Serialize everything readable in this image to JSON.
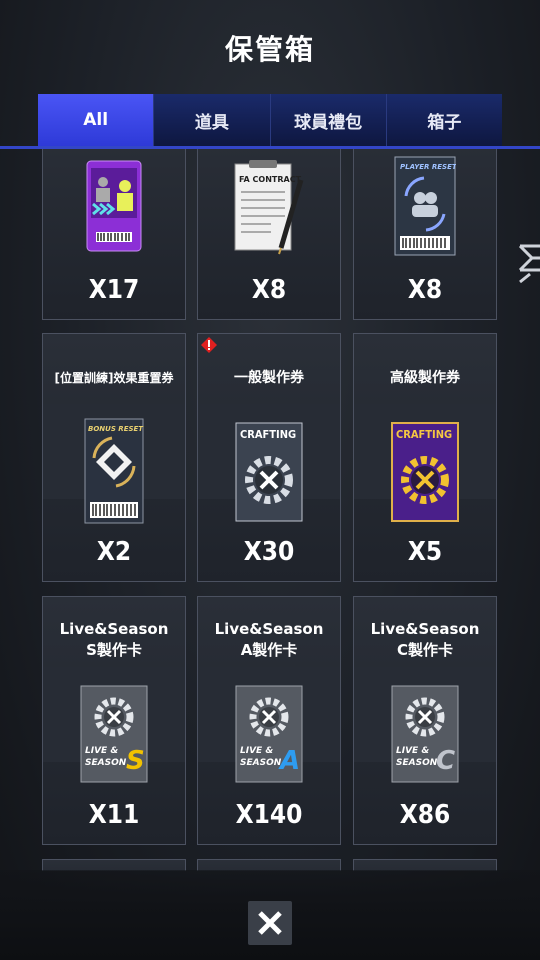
{
  "header": {
    "title": "保管箱"
  },
  "tabs": [
    {
      "label": "All",
      "active": true
    },
    {
      "label": "道具",
      "active": false
    },
    {
      "label": "球員禮包",
      "active": false
    },
    {
      "label": "箱子",
      "active": false
    }
  ],
  "items": [
    {
      "name": "",
      "qty": "X17",
      "icon": "player-change-ticket-icon"
    },
    {
      "name": "",
      "qty": "X8",
      "icon": "fa-contract-icon",
      "art_text": "FA CONTRACT"
    },
    {
      "name": "",
      "qty": "X8",
      "icon": "player-reset-ticket-icon",
      "art_text": "PLAYER RESET"
    },
    {
      "name": "[位置訓練]效果重置券",
      "qty": "X2",
      "icon": "bonus-reset-ticket-icon",
      "art_text": "BONUS RESET"
    },
    {
      "name": "一般製作券",
      "qty": "X30",
      "icon": "crafting-ticket-icon",
      "art_text": "CRAFTING"
    },
    {
      "name": "高級製作券",
      "qty": "X5",
      "icon": "premium-crafting-ticket-icon",
      "art_text": "CRAFTING"
    },
    {
      "name_line1": "Live&Season",
      "name_line2": "S製作卡",
      "qty": "X11",
      "icon": "live-season-s-card-icon",
      "art_text": "LIVE & SEASON",
      "grade": "S"
    },
    {
      "name_line1": "Live&Season",
      "name_line2": "A製作卡",
      "qty": "X140",
      "icon": "live-season-a-card-icon",
      "art_text": "LIVE & SEASON",
      "grade": "A"
    },
    {
      "name_line1": "Live&Season",
      "name_line2": "C製作卡",
      "qty": "X86",
      "icon": "live-season-c-card-icon",
      "art_text": "LIVE & SEASON",
      "grade": "C"
    }
  ],
  "colors": {
    "tab_active": "#3a46e6",
    "tab_inactive": "#13205a",
    "grade_s": "#f2c200",
    "grade_a": "#2e9cf0",
    "grade_c": "#c0c4cc",
    "crafting_premium": "#5a2aa0"
  },
  "footer": {
    "close_icon": "close-x-icon"
  }
}
